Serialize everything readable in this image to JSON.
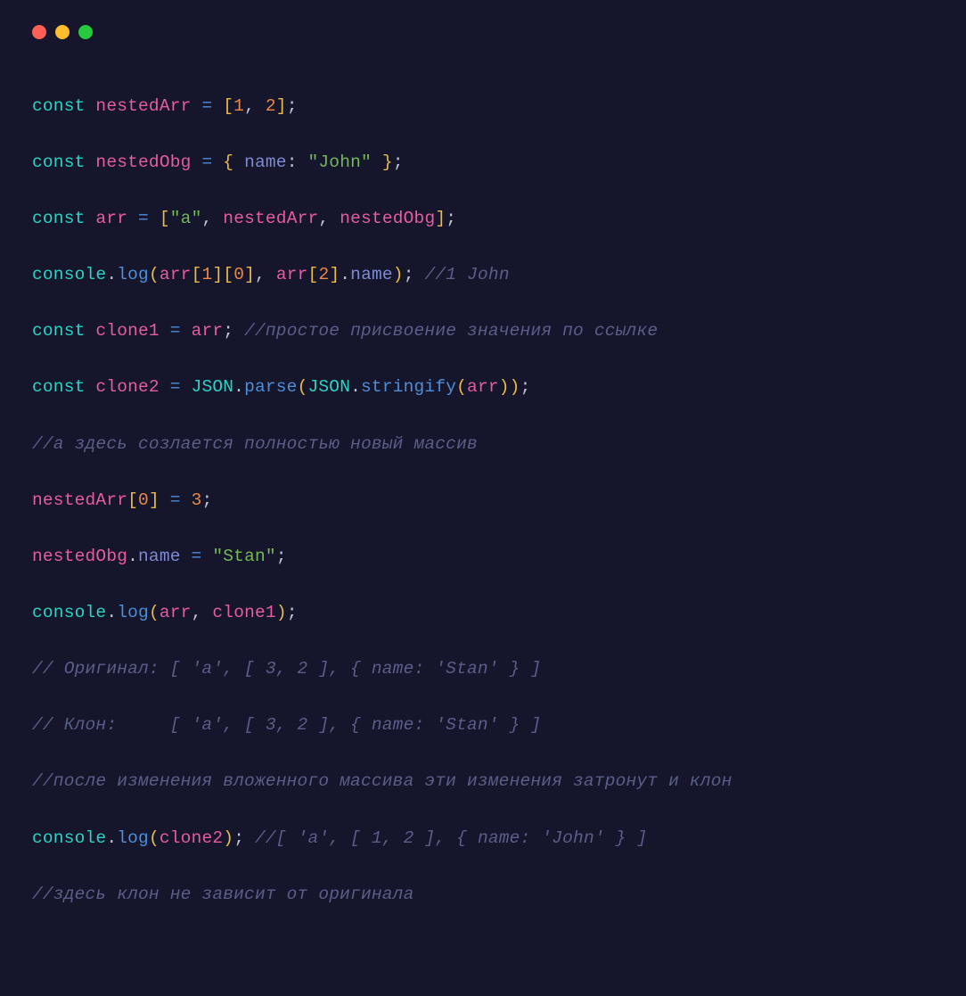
{
  "traffic": {
    "red": "#ff5f56",
    "yellow": "#ffbd2e",
    "green": "#27c93f"
  },
  "code": {
    "l1": {
      "kw": "const",
      "var": "nestedArr",
      "op": "=",
      "lb": "[",
      "n1": "1",
      "c": ",",
      "n2": "2",
      "rb": "]",
      "sc": ";"
    },
    "l2": {
      "kw": "const",
      "var": "nestedObg",
      "op": "=",
      "lb": "{",
      "prop": "name",
      "col": ":",
      "str": "\"John\"",
      "rb": "}",
      "sc": ";"
    },
    "l3": {
      "kw": "const",
      "var": "arr",
      "op": "=",
      "lb": "[",
      "str": "\"a\"",
      "c1": ",",
      "v1": "nestedArr",
      "c2": ",",
      "v2": "nestedObg",
      "rb": "]",
      "sc": ";"
    },
    "l4": {
      "obj": "console",
      "dot": ".",
      "fn": "log",
      "lp": "(",
      "v1": "arr",
      "lb1": "[",
      "n1": "1",
      "rb1": "]",
      "lb2": "[",
      "n2": "0",
      "rb2": "]",
      "c": ",",
      "v2": "arr",
      "lb3": "[",
      "n3": "2",
      "rb3": "]",
      "dot2": ".",
      "prop": "name",
      "rp": ")",
      "sc": ";",
      "cmt": "//1 John"
    },
    "l5": {
      "kw": "const",
      "var": "clone1",
      "op": "=",
      "v": "arr",
      "sc": ";",
      "cmt": "//простое присвоение значения по ссылке"
    },
    "l6": {
      "kw": "const",
      "var": "clone2",
      "op": "=",
      "obj1": "JSON",
      "dot1": ".",
      "fn1": "parse",
      "lp1": "(",
      "obj2": "JSON",
      "dot2": ".",
      "fn2": "stringify",
      "lp2": "(",
      "v": "arr",
      "rp2": ")",
      "rp1": ")",
      "sc": ";"
    },
    "l7": {
      "cmt": "//а здесь созлается полностью новый массив"
    },
    "l8": {
      "var": "nestedArr",
      "lb": "[",
      "n": "0",
      "rb": "]",
      "op": "=",
      "val": "3",
      "sc": ";"
    },
    "l9": {
      "var": "nestedObg",
      "dot": ".",
      "prop": "name",
      "op": "=",
      "str": "\"Stan\"",
      "sc": ";"
    },
    "l10": {
      "obj": "console",
      "dot": ".",
      "fn": "log",
      "lp": "(",
      "v1": "arr",
      "c": ",",
      "v2": "clone1",
      "rp": ")",
      "sc": ";"
    },
    "l11": {
      "cmt": "// Оригинал: [ 'a', [ 3, 2 ], { name: 'Stan' } ]"
    },
    "l12": {
      "cmt": "// Клон:     [ 'a', [ 3, 2 ], { name: 'Stan' } ]"
    },
    "l13": {
      "cmt": "//после изменения вложенного массива эти изменения затронут и клон"
    },
    "l14": {
      "obj": "console",
      "dot": ".",
      "fn": "log",
      "lp": "(",
      "v": "clone2",
      "rp": ")",
      "sc": ";",
      "cmt": "//[ 'a', [ 1, 2 ], { name: 'John' } ]"
    },
    "l15": {
      "cmt": "//здесь клон не зависит от оригинала"
    }
  }
}
